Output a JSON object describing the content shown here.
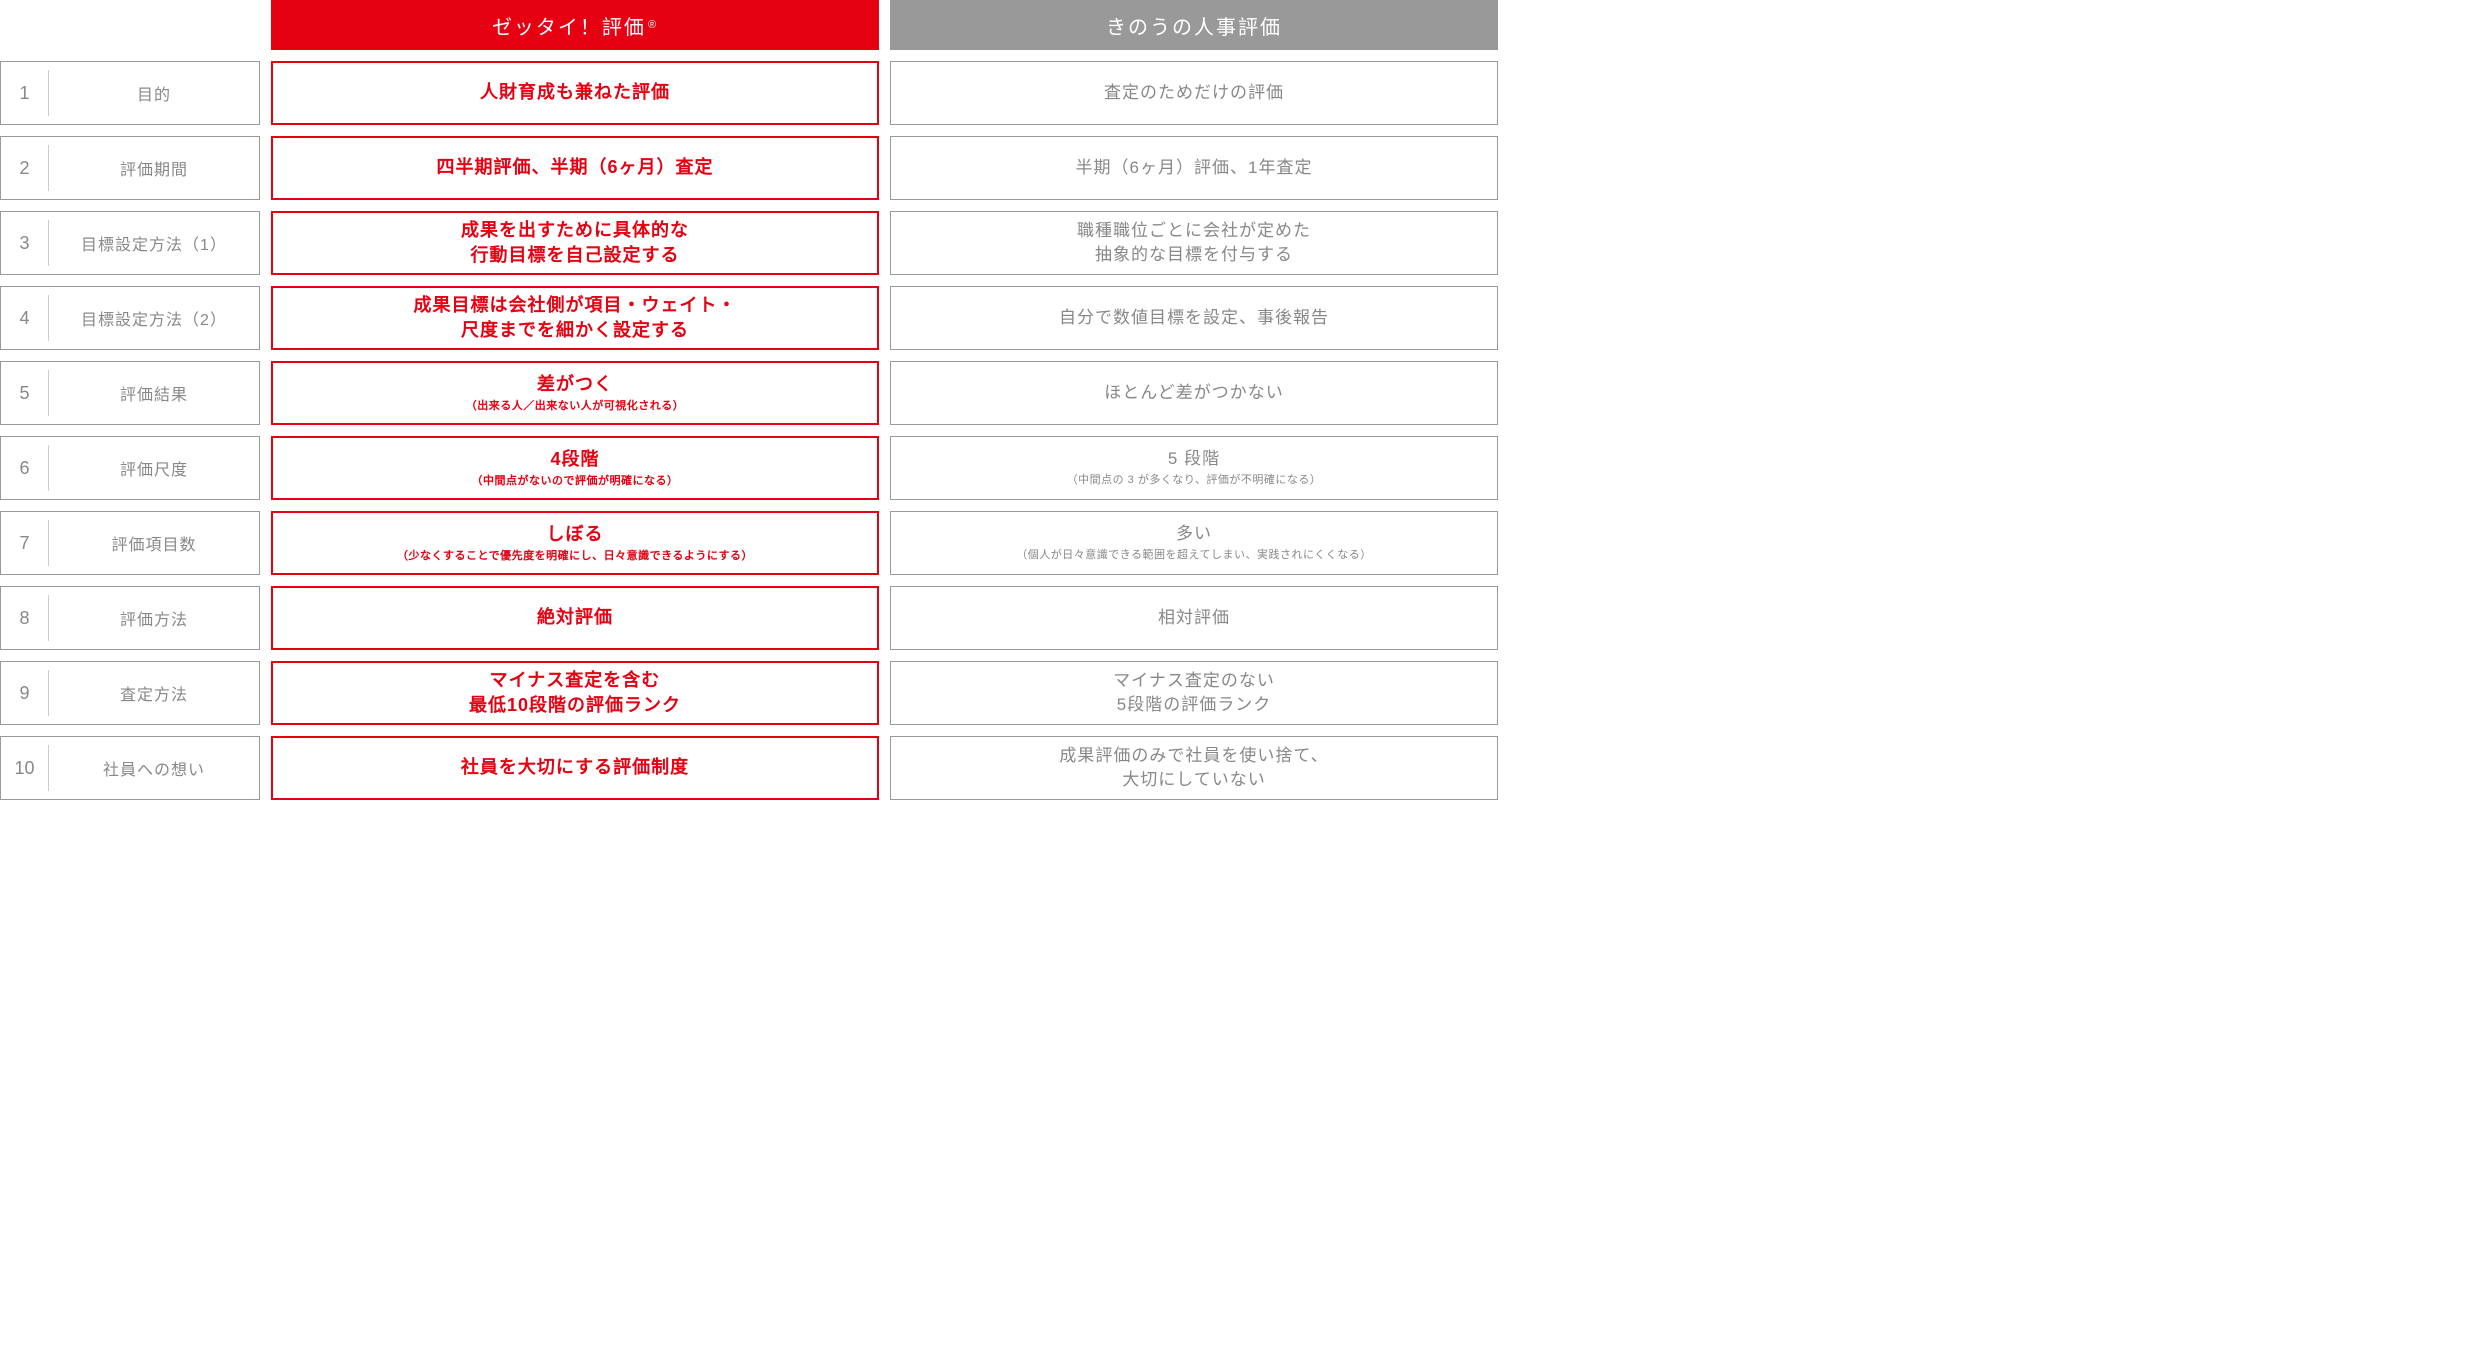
{
  "headers": {
    "red": "ゼッタイ！評価",
    "red_sup": "®",
    "gray": "きのうの人事評価"
  },
  "rows": [
    {
      "num": "1",
      "label": "目的",
      "red_main": "人財育成も兼ねた評価",
      "red_sub": "",
      "gray_main": "査定のためだけの評価",
      "gray_sub": ""
    },
    {
      "num": "2",
      "label": "評価期間",
      "red_main": "四半期評価、半期（6ヶ月）査定",
      "red_sub": "",
      "gray_main": "半期（6ヶ月）評価、1年査定",
      "gray_sub": ""
    },
    {
      "num": "3",
      "label": "目標設定方法（1）",
      "red_main": "成果を出すために具体的な\n行動目標を自己設定する",
      "red_sub": "",
      "gray_main": "職種職位ごとに会社が定めた\n抽象的な目標を付与する",
      "gray_sub": ""
    },
    {
      "num": "4",
      "label": "目標設定方法（2）",
      "red_main": "成果目標は会社側が項目・ウェイト・\n尺度までを細かく設定する",
      "red_sub": "",
      "gray_main": "自分で数値目標を設定、事後報告",
      "gray_sub": ""
    },
    {
      "num": "5",
      "label": "評価結果",
      "red_main": "差がつく",
      "red_sub": "（出来る人／出来ない人が可視化される）",
      "gray_main": "ほとんど差がつかない",
      "gray_sub": ""
    },
    {
      "num": "6",
      "label": "評価尺度",
      "red_main": "4段階",
      "red_sub": "（中間点がないので評価が明確になる）",
      "gray_main": "5 段階",
      "gray_sub": "（中間点の 3 が多くなり、評価が不明確になる）"
    },
    {
      "num": "7",
      "label": "評価項目数",
      "red_main": "しぼる",
      "red_sub": "（少なくすることで優先度を明確にし、日々意識できるようにする）",
      "gray_main": "多い",
      "gray_sub": "（個人が日々意識できる範囲を超えてしまい、実践されにくくなる）"
    },
    {
      "num": "8",
      "label": "評価方法",
      "red_main": "絶対評価",
      "red_sub": "",
      "gray_main": "相対評価",
      "gray_sub": ""
    },
    {
      "num": "9",
      "label": "査定方法",
      "red_main": "マイナス査定を含む\n最低10段階の評価ランク",
      "red_sub": "",
      "gray_main": "マイナス査定のない\n5段階の評価ランク",
      "gray_sub": ""
    },
    {
      "num": "10",
      "label": "社員への想い",
      "red_main": "社員を大切にする評価制度",
      "red_sub": "",
      "gray_main": "成果評価のみで社員を使い捨て、\n大切にしていない",
      "gray_sub": ""
    }
  ]
}
